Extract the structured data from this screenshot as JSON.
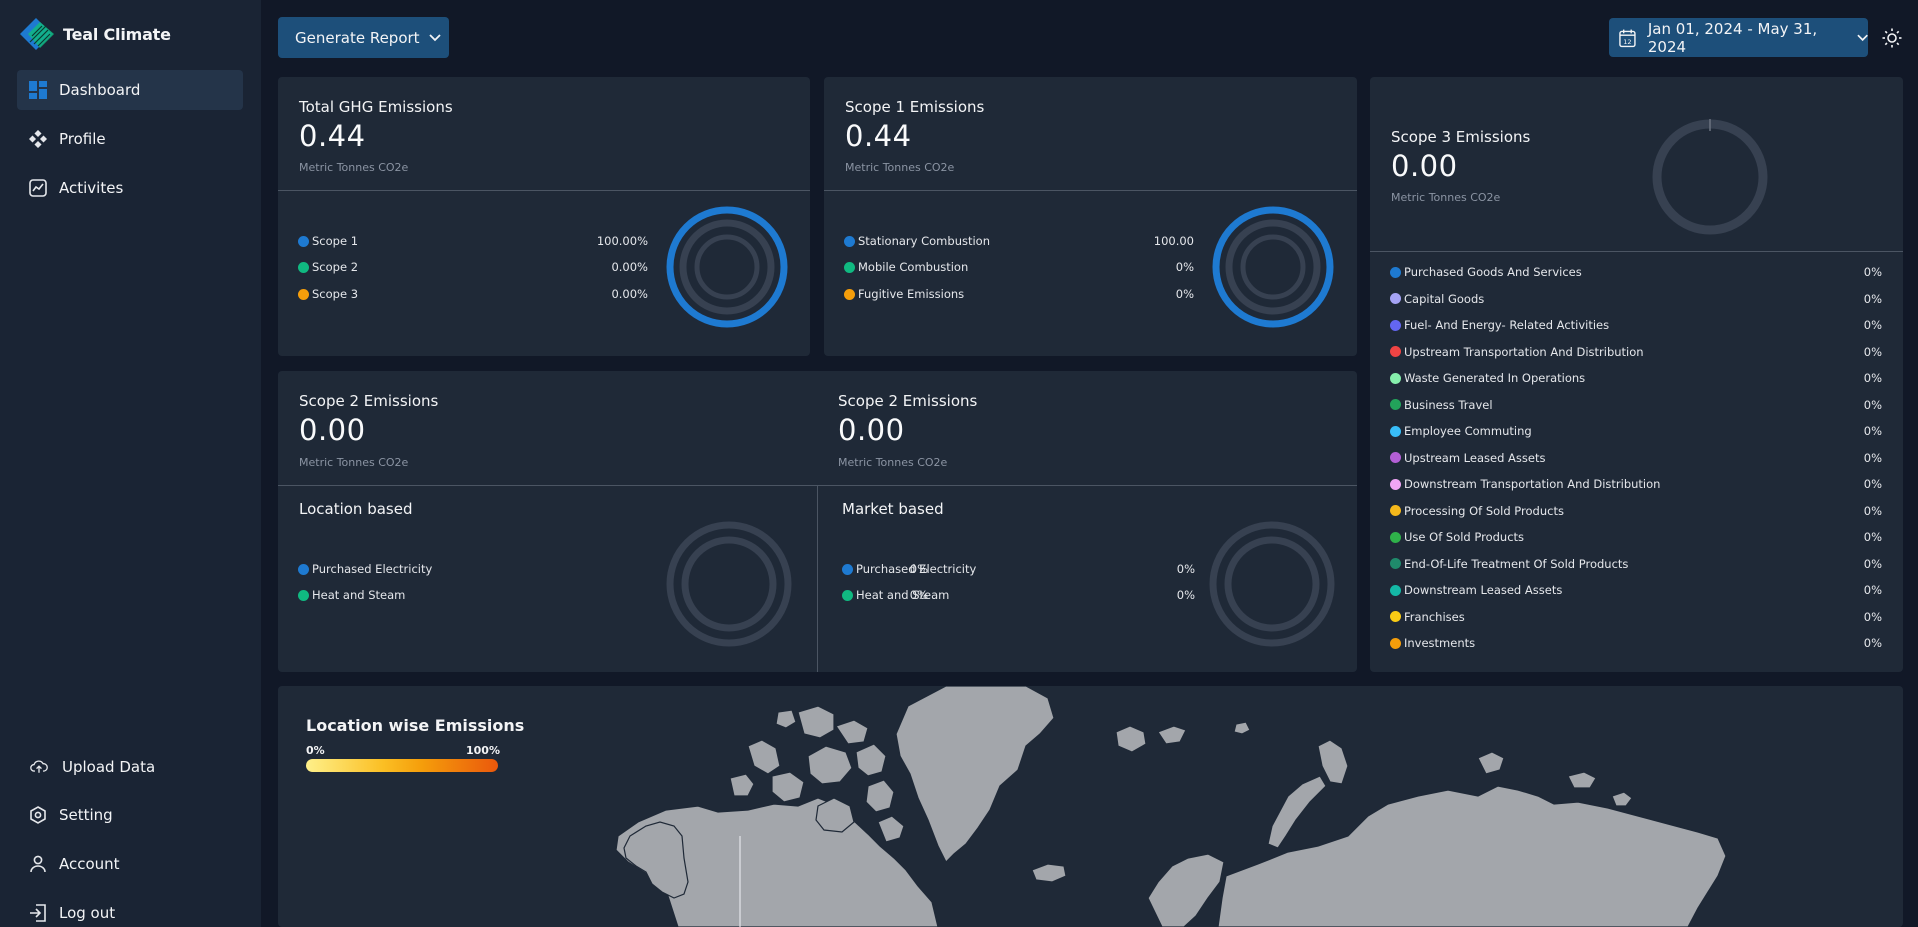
{
  "brand": {
    "name": "Teal Climate"
  },
  "sidebar": {
    "items": [
      {
        "label": "Dashboard",
        "icon": "dashboard-icon",
        "active": true
      },
      {
        "label": "Profile",
        "icon": "profile-icon"
      },
      {
        "label": "Activites",
        "icon": "activities-icon"
      }
    ],
    "bottom": [
      {
        "label": "Upload Data",
        "icon": "upload-cloud-icon"
      },
      {
        "label": "Setting",
        "icon": "settings-icon"
      },
      {
        "label": "Account",
        "icon": "user-icon"
      },
      {
        "label": "Log out",
        "icon": "logout-icon"
      }
    ]
  },
  "toolbar": {
    "generate_report": "Generate Report",
    "date_range": "Jan 01, 2024 - May 31, 2024"
  },
  "cards": {
    "total": {
      "title": "Total GHG Emissions",
      "value": "0.44",
      "unit": "Metric Tonnes CO2e",
      "legend": [
        {
          "label": "Scope 1",
          "value": "100.00%",
          "color": "#1e7ad1"
        },
        {
          "label": "Scope 2",
          "value": "0.00%",
          "color": "#10b981"
        },
        {
          "label": "Scope 3",
          "value": "0.00%",
          "color": "#f59e0b"
        }
      ]
    },
    "scope1": {
      "title": "Scope 1 Emissions",
      "value": "0.44",
      "unit": "Metric Tonnes CO2e",
      "legend": [
        {
          "label": "Stationary Combustion",
          "value": "100.00",
          "color": "#1e7ad1"
        },
        {
          "label": "Mobile Combustion",
          "value": "0%",
          "color": "#10b981"
        },
        {
          "label": "Fugitive Emissions",
          "value": "0%",
          "color": "#f59e0b"
        }
      ]
    },
    "scope2_location": {
      "title": "Scope 2 Emissions",
      "value": "0.00",
      "unit": "Metric Tonnes CO2e",
      "subtitle": "Location based",
      "legend": [
        {
          "label": "Purchased Electricity",
          "value": "0%",
          "color": "#1e7ad1"
        },
        {
          "label": "Heat and Steam",
          "value": "0%",
          "color": "#10b981"
        }
      ]
    },
    "scope2_market": {
      "title": "Scope 2 Emissions",
      "value": "0.00",
      "unit": "Metric Tonnes CO2e",
      "subtitle": "Market based",
      "legend": [
        {
          "label": "Purchased Electricity",
          "value": "0%",
          "color": "#1e7ad1"
        },
        {
          "label": "Heat and Steam",
          "value": "0%",
          "color": "#10b981"
        }
      ]
    },
    "scope3": {
      "title": "Scope 3 Emissions",
      "value": "0.00",
      "unit": "Metric Tonnes CO2e",
      "legend": [
        {
          "label": "Purchased Goods And Services",
          "value": "0%",
          "color": "#1e7ad1"
        },
        {
          "label": "Capital Goods",
          "value": "0%",
          "color": "#a5a3f5"
        },
        {
          "label": "Fuel- And Energy- Related Activities",
          "value": "0%",
          "color": "#6366f1"
        },
        {
          "label": "Upstream Transportation And Distribution",
          "value": "0%",
          "color": "#ef4444"
        },
        {
          "label": "Waste Generated In Operations",
          "value": "0%",
          "color": "#86efac"
        },
        {
          "label": "Business Travel",
          "value": "0%",
          "color": "#22a35a"
        },
        {
          "label": "Employee Commuting",
          "value": "0%",
          "color": "#38bdf8"
        },
        {
          "label": "Upstream Leased Assets",
          "value": "0%",
          "color": "#b45fd6"
        },
        {
          "label": "Downstream Transportation And Distribution",
          "value": "0%",
          "color": "#f0a5f5"
        },
        {
          "label": "Processing Of Sold Products",
          "value": "0%",
          "color": "#f5b81b"
        },
        {
          "label": "Use Of Sold Products",
          "value": "0%",
          "color": "#2fb14a"
        },
        {
          "label": "End-Of-Life Treatment Of Sold Products",
          "value": "0%",
          "color": "#1f8a6b"
        },
        {
          "label": "Downstream Leased Assets",
          "value": "0%",
          "color": "#14b8a6"
        },
        {
          "label": "Franchises",
          "value": "0%",
          "color": "#facc15"
        },
        {
          "label": "Investments",
          "value": "0%",
          "color": "#f59e0b"
        }
      ]
    }
  },
  "map": {
    "title": "Location wise Emissions",
    "scale_min": "0%",
    "scale_max": "100%"
  },
  "colors": {
    "accent": "#1e7ad1",
    "button": "#1d4f7a",
    "card": "#1f2937",
    "sidebar": "#1a2434",
    "background": "#111827"
  }
}
